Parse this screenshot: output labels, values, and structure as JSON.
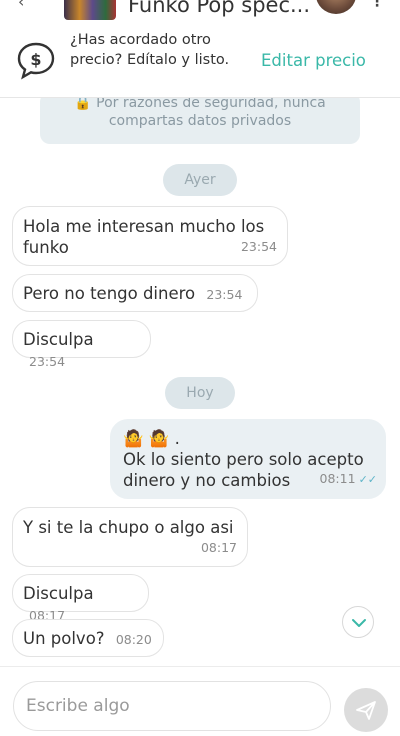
{
  "header": {
    "title": "Funko Pop spec..."
  },
  "banner": {
    "text": "¿Has acordado otro precio? Edítalo y listo.",
    "action": "Editar precio"
  },
  "chat": {
    "security_notice": "🔒 Por razones de seguridad, nunca compartas datos privados",
    "days": [
      "Ayer",
      "Hoy"
    ],
    "messages": [
      {
        "text": "Hola me interesan mucho los funko",
        "time": "23:54",
        "sent": false
      },
      {
        "text": "Pero no tengo dinero",
        "time": "23:54",
        "sent": false
      },
      {
        "text": "Disculpa",
        "time": "23:54",
        "sent": false
      },
      {
        "text": "🤷 🤷 .\nOk lo siento pero solo acepto dinero y no cambios",
        "time": "08:11",
        "sent": true
      },
      {
        "text": "Y si te la chupo o algo asi",
        "time": "08:17",
        "sent": false
      },
      {
        "text": "Disculpa",
        "time": "08:17",
        "sent": false
      },
      {
        "text": "Un polvo?",
        "time": "08:20",
        "sent": false
      }
    ]
  },
  "input": {
    "placeholder": "Escribe algo"
  },
  "colors": {
    "accent": "#3ab8a8",
    "sent_bubble": "#eaf0f3",
    "day_pill": "#dde6ea"
  }
}
